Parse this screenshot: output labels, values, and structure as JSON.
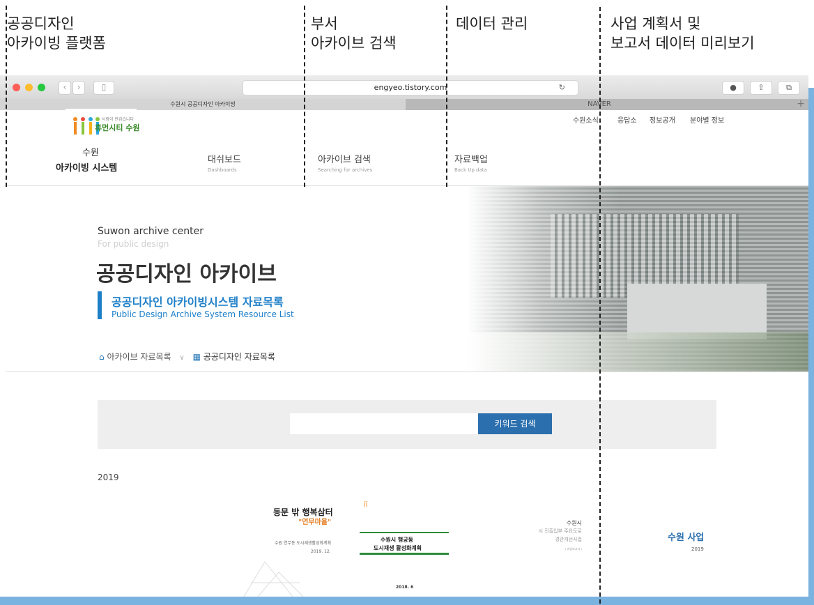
{
  "annotations": {
    "col1_line1": "공공디자인",
    "col1_line2": "아카이빙 플랫폼",
    "col2_line1": "부서",
    "col2_line2": "아카이브 검색",
    "col3_line1": "데이터 관리",
    "col4_line1": "사업 계획서 및",
    "col4_line2": "보고서 데이터 미리보기"
  },
  "browser": {
    "url": "engyeo.tistory.com",
    "back_icon": "chevron-left-icon",
    "forward_icon": "chevron-right-icon",
    "tabs": [
      "수원시 공공디자인 아카이빙",
      "NAVER"
    ],
    "new_tab": "+"
  },
  "site": {
    "logo_small": "사람이 반갑습니다",
    "logo_main": "휴먼시티 수원",
    "title_line1": "수원",
    "title_line2": "아카이빙 시스템",
    "gnb": [
      "수원소식",
      "응답소",
      "정보공개",
      "분야별 정보"
    ],
    "menu": [
      {
        "ko": "대쉬보드",
        "en": "Dashboards"
      },
      {
        "ko": "아카이브 검색",
        "en": "Searching for archives"
      },
      {
        "ko": "자료백업",
        "en": "Back Up data"
      }
    ]
  },
  "hero": {
    "eyebrow": "Suwon archive center",
    "sub_eyebrow": "For public design",
    "title": "공공디자인 아카이브",
    "subtitle_ko": "공공디자인 아카이빙시스템 자료목록",
    "subtitle_en": "Public Design Archive System Resource List",
    "breadcrumb_1": "아카이브 자료목록",
    "breadcrumb_sep": "∨",
    "breadcrumb_2": "공공디자인 자료목록"
  },
  "search": {
    "placeholder": "",
    "button": "키워드 검색"
  },
  "year": "2019",
  "cards": [
    {
      "title1": "동문 밖 행복삼터",
      "title2": "\"연무마을\"",
      "desc": "수원 연무동 도시재생활성화계획",
      "date": "2019. 12."
    },
    {
      "title1": "수원시 행궁동",
      "title2": "도시재생 활성화계획",
      "date": "2018. 6"
    },
    {
      "title1": "수원시",
      "title2": "시 진출입부 주요도로",
      "title3": "경관개선사업",
      "tag": "( 과업보고서 )"
    },
    {
      "title1": "수원 사업",
      "date": "2019"
    }
  ],
  "colors": {
    "accent": "#1e7fc8",
    "button": "#2c6fae",
    "side": "#7bb3e0"
  }
}
